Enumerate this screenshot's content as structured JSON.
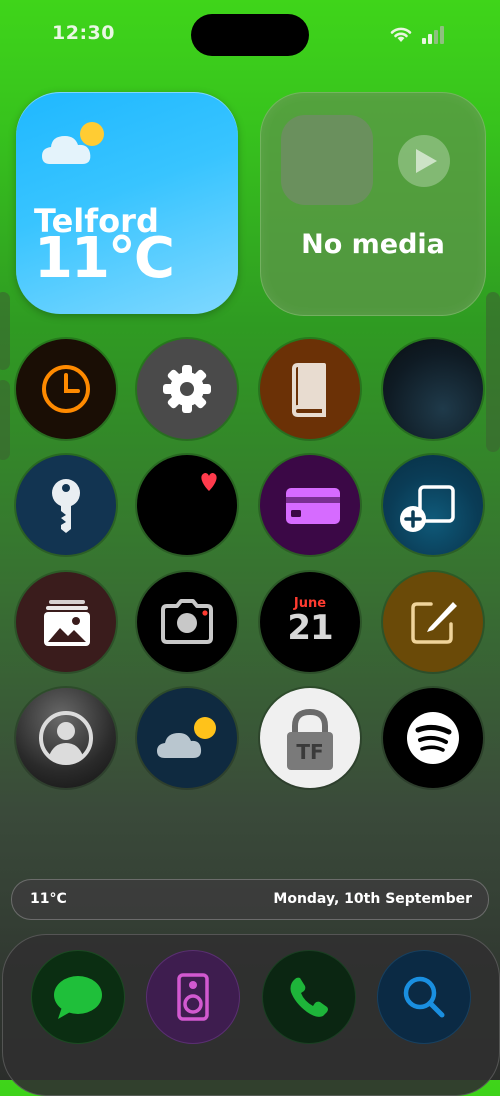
{
  "status_bar": {
    "time": "12:30",
    "wifi_icon": "wifi-icon",
    "signal_icon": "cellular-signal-icon"
  },
  "weather_widget": {
    "city": "Telford",
    "temperature": "11°C",
    "icon": "partly-cloudy-icon"
  },
  "media_widget": {
    "label": "No media",
    "icon": "play-icon"
  },
  "apps": [
    {
      "name": "clock",
      "icon": "clock-icon"
    },
    {
      "name": "settings",
      "icon": "gear-icon"
    },
    {
      "name": "books",
      "icon": "book-icon"
    },
    {
      "name": "blank",
      "icon": "blank-icon"
    },
    {
      "name": "passwords",
      "icon": "key-icon"
    },
    {
      "name": "health",
      "icon": "heart-icon"
    },
    {
      "name": "wallet",
      "icon": "credit-card-icon"
    },
    {
      "name": "screen-mirroring",
      "icon": "add-screen-icon"
    },
    {
      "name": "photos",
      "icon": "photos-icon"
    },
    {
      "name": "camera",
      "icon": "camera-icon"
    },
    {
      "name": "calendar",
      "icon": "calendar-icon",
      "month": "June",
      "day": "21"
    },
    {
      "name": "notes",
      "icon": "pencil-note-icon"
    },
    {
      "name": "contacts",
      "icon": "person-icon"
    },
    {
      "name": "weather",
      "icon": "partly-cloudy-icon"
    },
    {
      "name": "tf-lock",
      "icon": "padlock-icon",
      "letters": "TF"
    },
    {
      "name": "spotify",
      "icon": "spotify-icon"
    }
  ],
  "info_bar": {
    "temperature": "11°C",
    "date": "Monday, 10th September"
  },
  "dock": [
    {
      "name": "messages",
      "icon": "chat-bubble-icon"
    },
    {
      "name": "music",
      "icon": "speaker-icon"
    },
    {
      "name": "phone",
      "icon": "phone-icon"
    },
    {
      "name": "search",
      "icon": "magnifier-icon"
    }
  ]
}
